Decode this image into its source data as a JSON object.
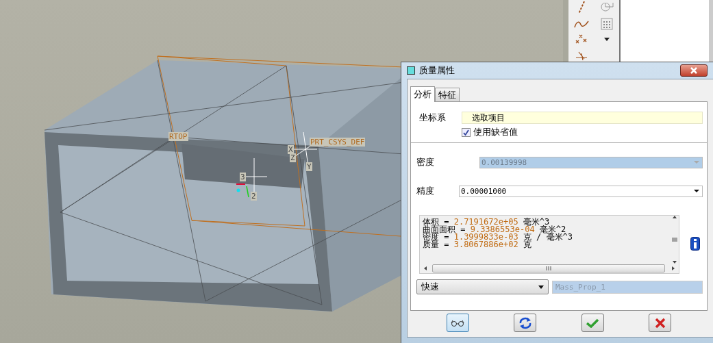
{
  "viewport": {
    "datum_labels": [
      {
        "text": "RTOP"
      },
      {
        "text": "PRT_CSYS_DEF"
      }
    ],
    "axis_labels": [
      "X",
      "Z",
      "Y",
      "3",
      "2"
    ]
  },
  "dialog": {
    "title": "质量属性",
    "tabs": [
      {
        "label": "分析",
        "selected": true
      },
      {
        "label": "特征",
        "selected": false
      }
    ],
    "coordinate_system": {
      "label": "坐标系",
      "placeholder": "选取项目"
    },
    "use_default": {
      "label": "使用缺省值",
      "checked": true
    },
    "density": {
      "label": "密度",
      "value": "0.00139998",
      "disabled": true
    },
    "precision": {
      "label": "精度",
      "value": "0.00001000",
      "disabled": false
    },
    "results": [
      {
        "label": "体积 =",
        "value": "2.7191672e+05",
        "unit": "毫米^3"
      },
      {
        "label": "曲面面积 =",
        "value": "9.3386553e-04",
        "unit": "毫米^2"
      },
      {
        "label": "密度 =",
        "value": "1.3999833e-03",
        "unit": "克 / 毫米^3"
      },
      {
        "label": "质量 =",
        "value": "3.8067886e+02",
        "unit": "克"
      }
    ],
    "method": {
      "value": "快速"
    },
    "feature_name": {
      "value": "Mass_Prop_1"
    }
  }
}
